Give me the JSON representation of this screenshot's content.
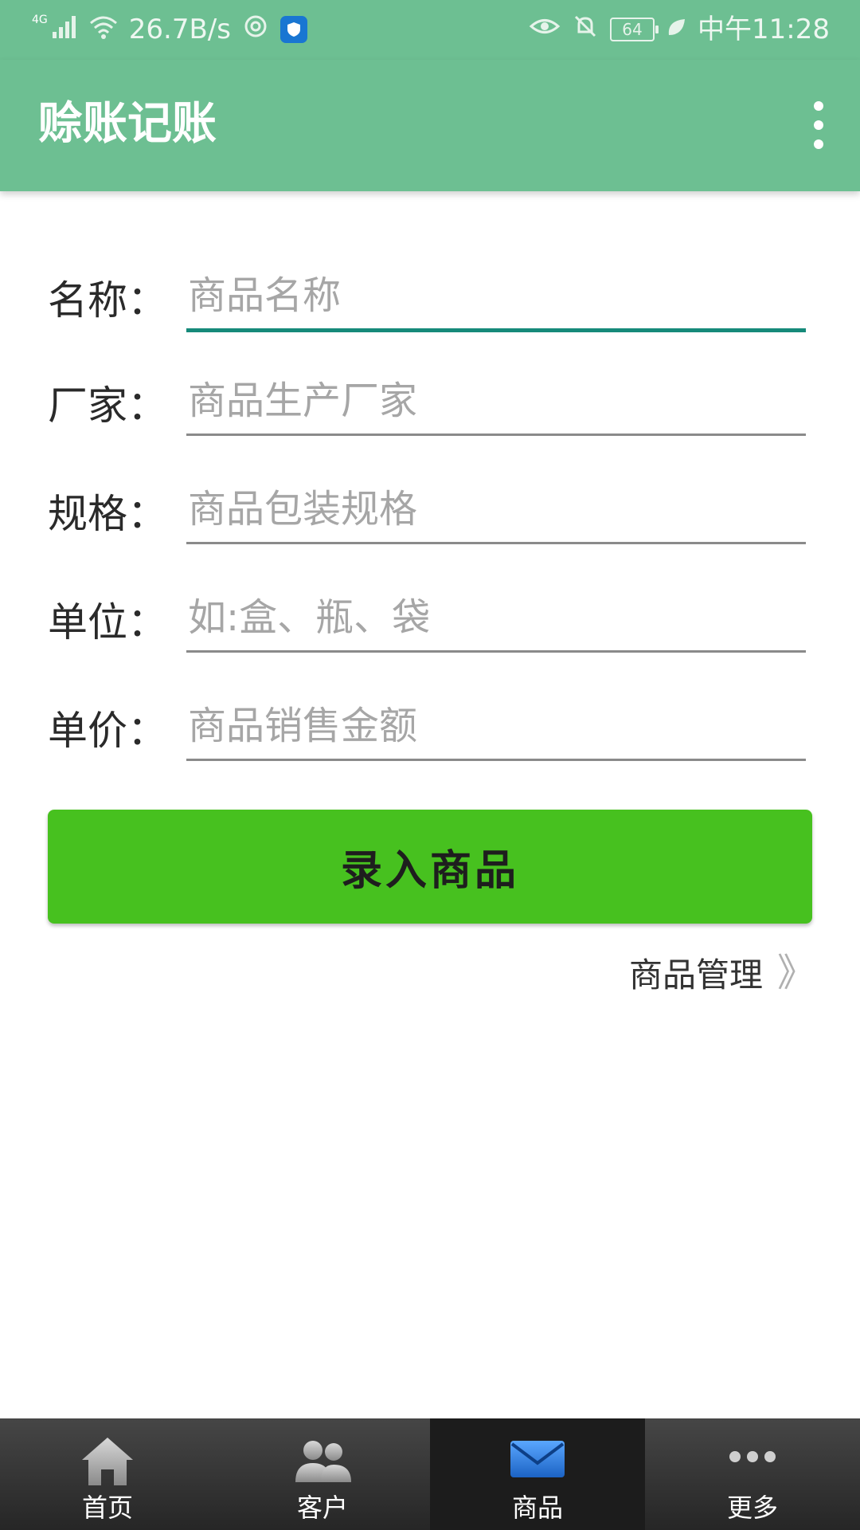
{
  "status_bar": {
    "network_type": "4G",
    "speed": "26.7B/s",
    "battery": "64",
    "time": "中午11:28"
  },
  "app_bar": {
    "title": "赊账记账"
  },
  "form": {
    "name": {
      "label": "名称：",
      "placeholder": "商品名称"
    },
    "manufacturer": {
      "label": "厂家：",
      "placeholder": "商品生产厂家"
    },
    "spec": {
      "label": "规格：",
      "placeholder": "商品包装规格"
    },
    "unit": {
      "label": "单位：",
      "placeholder": "如:盒、瓶、袋"
    },
    "price": {
      "label": "单价：",
      "placeholder": "商品销售金额"
    }
  },
  "submit_label": "录入商品",
  "manage_link": {
    "label": "商品管理",
    "chevron": "》"
  },
  "bottom_nav": {
    "items": [
      {
        "label": "首页",
        "icon": "home-icon"
      },
      {
        "label": "客户",
        "icon": "customers-icon"
      },
      {
        "label": "商品",
        "icon": "mail-icon"
      },
      {
        "label": "更多",
        "icon": "more-icon"
      }
    ],
    "active_index": 2
  },
  "colors": {
    "app_bar": "#6dbf92",
    "submit_button": "#47c11f",
    "focus_underline": "#168a7a"
  }
}
